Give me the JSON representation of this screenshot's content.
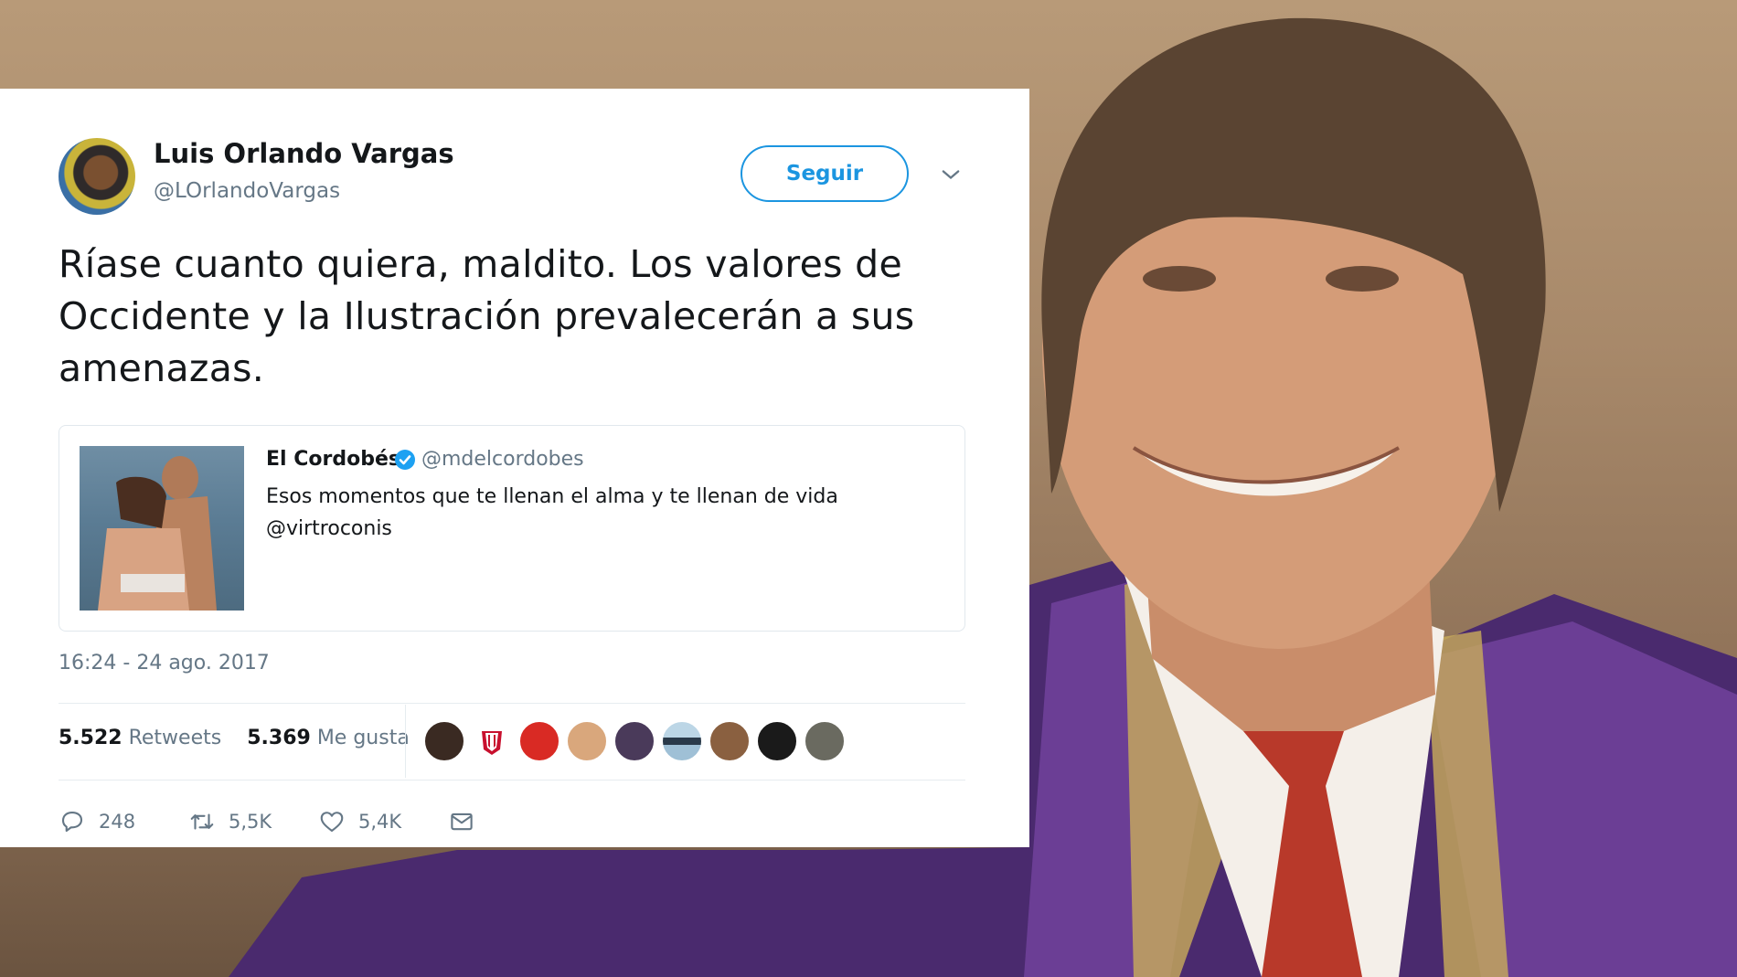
{
  "tweet": {
    "author_name": "Luis Orlando Vargas",
    "author_handle": "@LOrlandoVargas",
    "follow_label": "Seguir",
    "text": "Ríase cuanto quiera, maldito. Los valores de Occidente y la Ilustración prevalecerán a sus amenazas.",
    "quoted": {
      "name": "El Cordobés",
      "handle": "@mdelcordobes",
      "text": "Esos momentos que te llenan el alma y te llenan de vida @virtroconis",
      "verified_icon": "verified-badge-icon"
    },
    "timestamp": "16:24 - 24 ago. 2017",
    "stats": {
      "retweets_count": "5.522",
      "retweets_label": "Retweets",
      "likes_count": "5.369",
      "likes_label": "Me gusta"
    },
    "actions": {
      "reply_count": "248",
      "retweet_count": "5,5K",
      "like_count": "5,4K"
    }
  },
  "colors": {
    "accent": "#1b95e0",
    "secondary_text": "#657786",
    "primary_text": "#14171a",
    "verified": "#1da1f2"
  },
  "icons": [
    "chevron-down-icon",
    "verified-badge-icon",
    "reply-icon",
    "retweet-icon",
    "like-icon",
    "message-icon"
  ]
}
